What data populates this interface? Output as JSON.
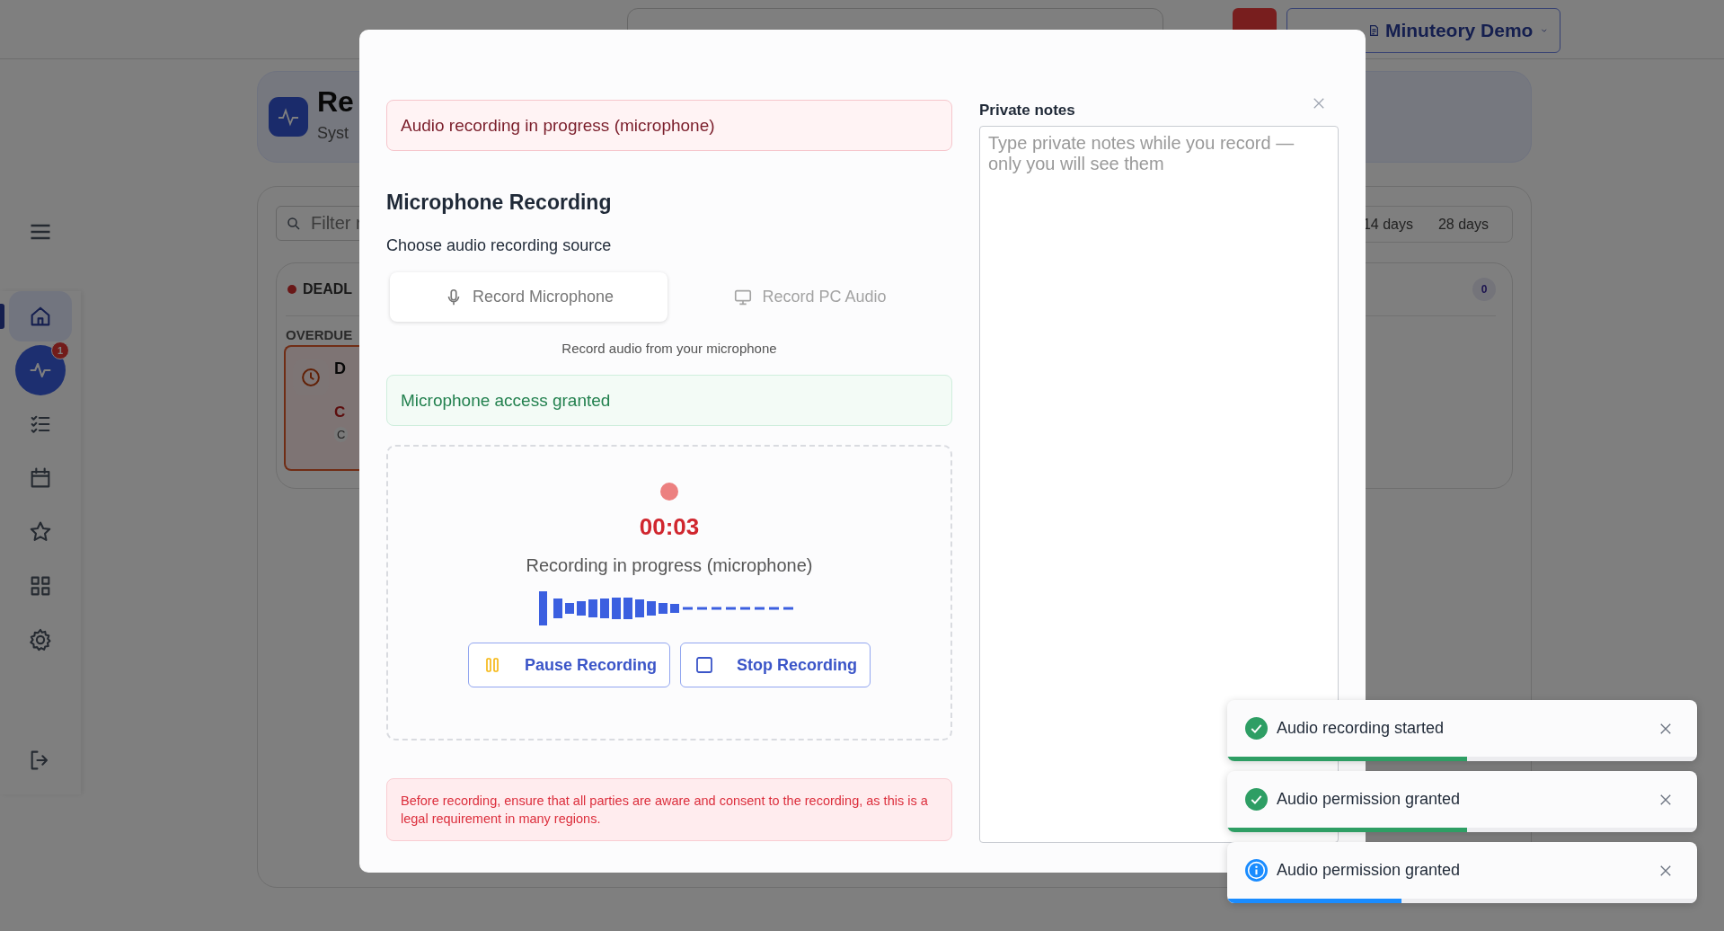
{
  "top_bar": {
    "workspace": "Minuteory Demo"
  },
  "sidebar": {
    "items": [
      {
        "kind": "nav",
        "selected": true
      },
      {
        "kind": "record",
        "selected": false,
        "badge": "1"
      },
      {
        "kind": "nav",
        "selected": false
      },
      {
        "kind": "nav",
        "selected": false
      },
      {
        "kind": "nav",
        "selected": false
      },
      {
        "kind": "nav",
        "selected": false
      },
      {
        "kind": "nav",
        "selected": false
      },
      {
        "kind": "logout",
        "selected": false
      }
    ]
  },
  "header": {
    "title": "Re",
    "subtitle": "Syst"
  },
  "main": {
    "filter": {
      "placeholder": "Filter r"
    },
    "range_options": [
      {
        "label": "14 days",
        "selected": false
      },
      {
        "label": "28 days",
        "selected": false
      }
    ],
    "deadlines": {
      "title": "DEADL",
      "count": "0",
      "group": "OVERDUE",
      "item": {
        "title": "D",
        "status": "C",
        "tag": "C"
      }
    }
  },
  "modal": {
    "banner": "Audio recording in progress (microphone)",
    "heading": "Microphone Recording",
    "source_label": "Choose audio recording source",
    "sources": [
      {
        "label": "Record Microphone",
        "selected": true
      },
      {
        "label": "Record PC Audio",
        "selected": false
      }
    ],
    "source_hint": "Record audio from your microphone",
    "access_message": "Microphone access granted",
    "recorder": {
      "time": "00:03",
      "status": "Recording in progress (microphone)",
      "buttons": [
        {
          "kind": "pause",
          "label": "Pause Recording"
        },
        {
          "kind": "stop",
          "label": "Stop Recording"
        }
      ]
    },
    "consent_notice": "Before recording, ensure that all parties are aware and consent to the recording, as this is a legal requirement in many regions.",
    "notes": {
      "label": "Private notes",
      "placeholder": "Type private notes while you record — only you will see them"
    }
  },
  "toasts": [
    {
      "kind": "success",
      "message": "Audio recording started",
      "level": 0.51
    },
    {
      "kind": "success",
      "message": "Audio permission granted",
      "level": 0.51
    },
    {
      "kind": "info",
      "message": "Audio permission granted",
      "level": 0.37
    }
  ]
}
